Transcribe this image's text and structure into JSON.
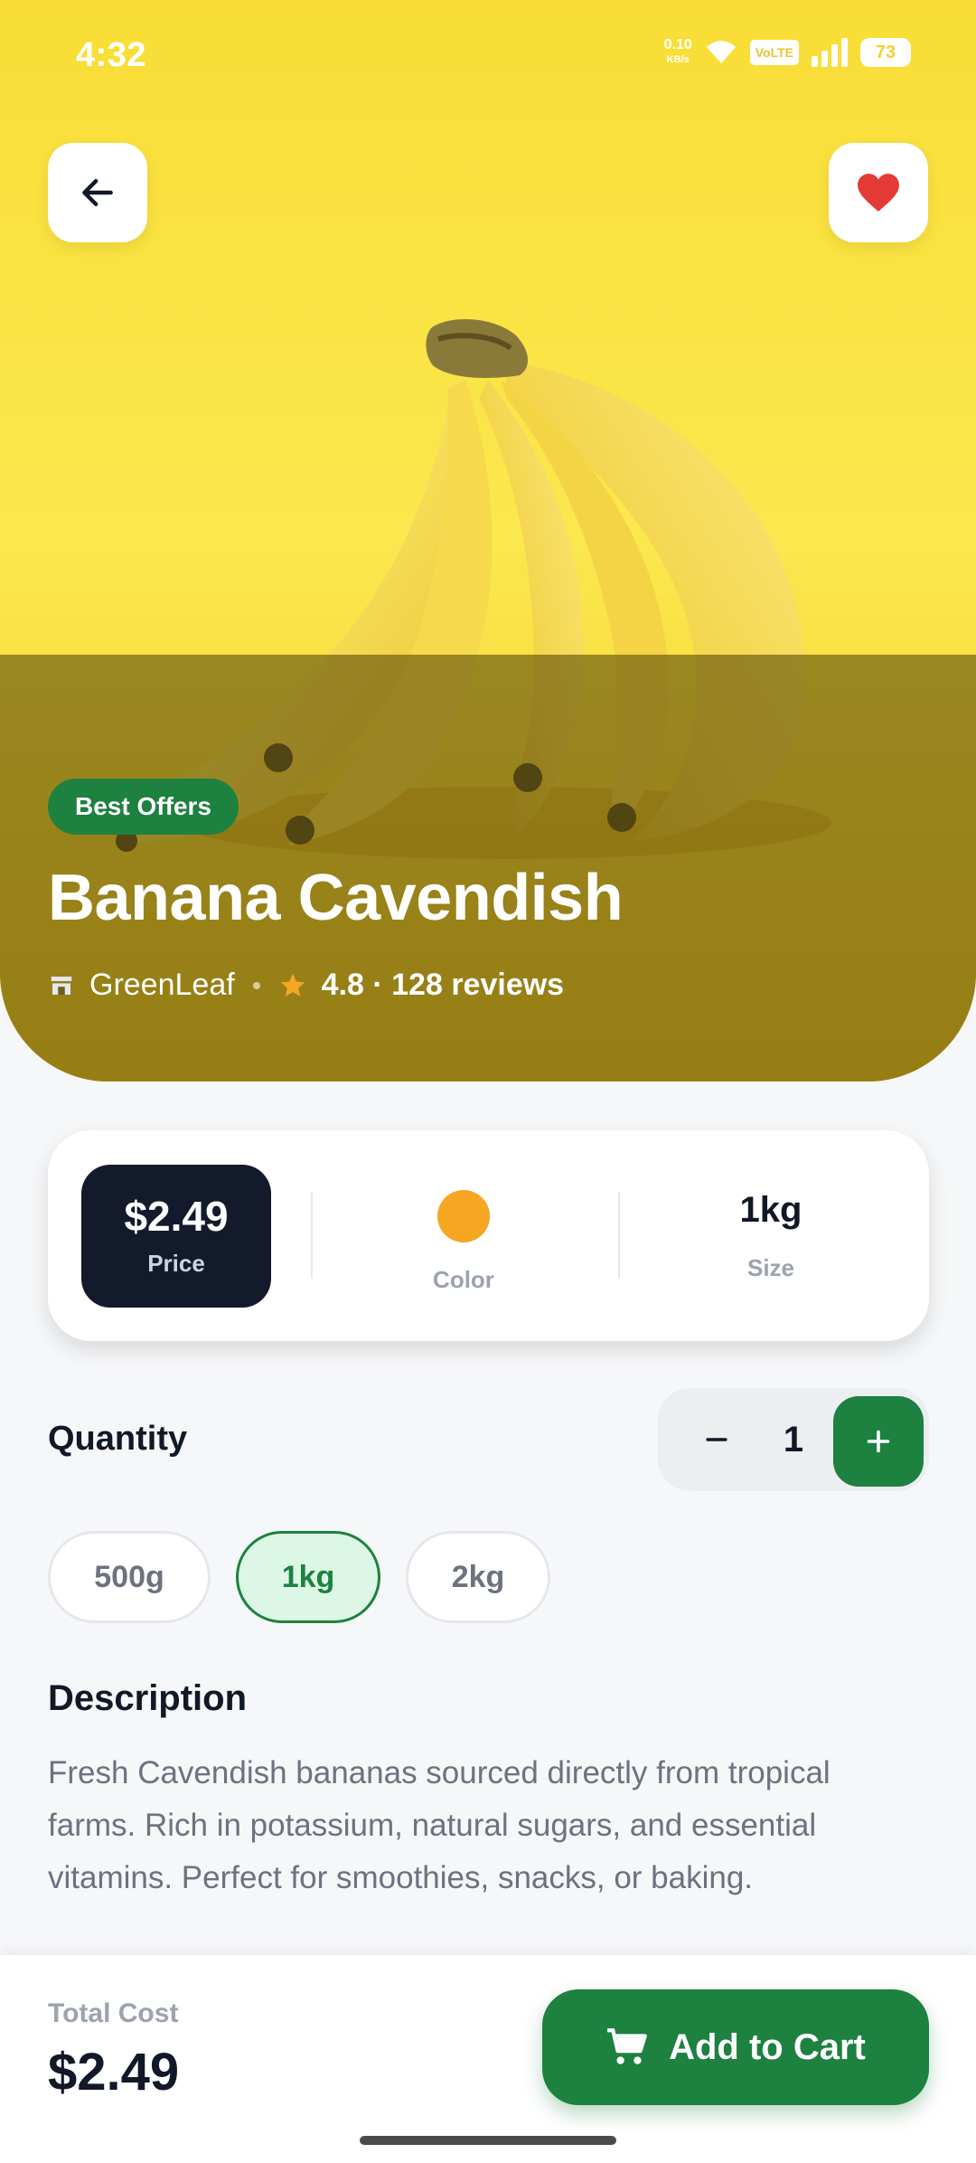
{
  "status_bar": {
    "time": "4:32",
    "net_speed_value": "0.10",
    "net_speed_unit": "KB/s",
    "volte": "VoLTE",
    "battery": "73"
  },
  "header": {
    "back_icon": "arrow-left-icon",
    "favorite_icon": "heart-icon",
    "favorite_color": "#e53935"
  },
  "product": {
    "badge": "Best Offers",
    "name": "Banana Cavendish",
    "store_icon": "store-icon",
    "store": "GreenLeaf",
    "rating_icon": "star-icon",
    "rating_text": "4.8 · 128 reviews"
  },
  "info": {
    "price": "$2.49",
    "price_label": "Price",
    "color_value": "#f5a623",
    "color_label": "Color",
    "size": "1kg",
    "size_label": "Size"
  },
  "quantity": {
    "label": "Quantity",
    "value": "1",
    "minus_icon": "minus-icon",
    "plus_icon": "plus-icon"
  },
  "weights": {
    "options": [
      "500g",
      "1kg",
      "2kg"
    ],
    "selected": "1kg"
  },
  "description": {
    "title": "Description",
    "text": "Fresh Cavendish bananas sourced directly from tropical farms. Rich in potassium, natural sugars, and essential vitamins. Perfect for smoothies, snacks, or baking."
  },
  "footer": {
    "total_label": "Total Cost",
    "total_value": "$2.49",
    "cart_icon": "cart-icon",
    "cart_label": "Add to Cart"
  },
  "colors": {
    "accent_green": "#1d8140",
    "dark_navy": "#131a2b",
    "hero_yellow": "#ffe445",
    "star": "#f5a623"
  }
}
